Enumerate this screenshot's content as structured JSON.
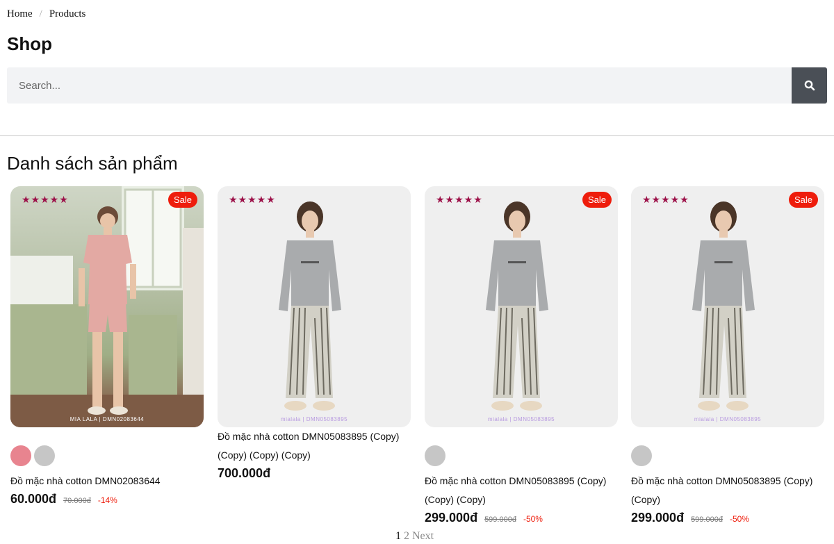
{
  "breadcrumb": {
    "home": "Home",
    "separator": "/",
    "current": "Products"
  },
  "page_title": "Shop",
  "search": {
    "placeholder": "Search...",
    "button_icon": "search-icon"
  },
  "section_title": "Danh sách sản phẩm",
  "colors": {
    "accent_dark": "#4a4f56",
    "sale": "#ee1d0c",
    "stars": "#9c1048"
  },
  "products": [
    {
      "stars": "★★★★★",
      "sale_badge": "Sale",
      "watermark": "MIA LALA | DMN02083644",
      "swatches": [
        "#e8848f",
        "#c6c6c6"
      ],
      "name": "Đồ mặc nhà cotton DMN02083644",
      "price": "60.000đ",
      "old_price": "70.000đ",
      "discount": "-14%"
    },
    {
      "stars": "★★★★★",
      "sale_badge": "",
      "watermark": "mialala | DMN05083895",
      "swatches": [],
      "name": "Đồ mặc nhà cotton DMN05083895 (Copy) (Copy) (Copy) (Copy)",
      "price": "700.000đ",
      "old_price": "",
      "discount": ""
    },
    {
      "stars": "★★★★★",
      "sale_badge": "Sale",
      "watermark": "mialala | DMN05083895",
      "swatches": [
        "#c6c6c6"
      ],
      "name": "Đồ mặc nhà cotton DMN05083895 (Copy) (Copy) (Copy)",
      "price": "299.000đ",
      "old_price": "599.000đ",
      "discount": "-50%"
    },
    {
      "stars": "★★★★★",
      "sale_badge": "Sale",
      "watermark": "mialala | DMN05083895",
      "swatches": [
        "#c6c6c6"
      ],
      "name": "Đồ mặc nhà cotton DMN05083895 (Copy) (Copy)",
      "price": "299.000đ",
      "old_price": "599.000đ",
      "discount": "-50%"
    }
  ],
  "pagination": {
    "current": "1",
    "page2": "2",
    "next": "Next"
  }
}
